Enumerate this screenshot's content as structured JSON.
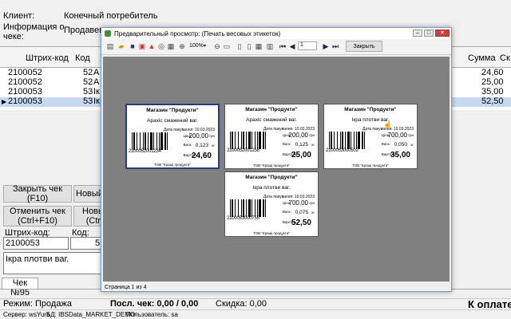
{
  "info": {
    "client_label": "Клиент:",
    "client_value": "Конечный потребитель",
    "receipt_info_label": "Информация о\nчеке:",
    "seller_label": "Продавец:"
  },
  "grid": {
    "columns": [
      "Штрих-код",
      "Код",
      "Сумма",
      "Ск"
    ],
    "rows": [
      {
        "barcode": "2100052",
        "code": "52",
        "name_frag": "А",
        "sum": "24,60",
        "selected": false
      },
      {
        "barcode": "2100052",
        "code": "52",
        "name_frag": "А",
        "sum": "25,00",
        "selected": false
      },
      {
        "barcode": "2100053",
        "code": "53",
        "name_frag": "Ік",
        "sum": "35,00",
        "selected": false
      },
      {
        "barcode": "2100053",
        "code": "53",
        "name_frag": "Ік",
        "sum": "52,50",
        "selected": true
      }
    ]
  },
  "buttons": {
    "close_receipt": "Закрыть чек (F10)",
    "new_frag": "Новый",
    "cancel_receipt": "Отменить чек\n(Ctrl+F10)",
    "new2_frag": "Новы\n(Ctr"
  },
  "inputs": {
    "barcode_label": "Штрих-код:",
    "barcode_value": "2100053",
    "code_label": "Код:",
    "code_value": "53",
    "product_name": "Ікра плотви ваг."
  },
  "tab": "Чек №95",
  "status": {
    "mode": "Режим: Продажа",
    "last_receipt": "Посл. чек: 0,00 / 0,00",
    "discount": "Скидка: 0,00",
    "to_pay": "К оплате"
  },
  "bottom_bar": {
    "server": "Сервер: wsYura",
    "db": "БД: IBSData_MARKET_DEMO",
    "user": "Пользователь: sa"
  },
  "dialog": {
    "title": "Предварительный просмотр: (Печать весовых этикеток)",
    "zoom": "100%",
    "page_input": "1",
    "close_button": "Закрыть",
    "status_text": "Страница 1 из 4",
    "icons": [
      "print-icon",
      "open-icon",
      "save-icon",
      "pdf-icon",
      "find-icon",
      "zoom-icon",
      "zoom-out-icon",
      "zoom-in-icon",
      "page-setup-icon",
      "first-page-icon",
      "prev-page-icon",
      "next-page-icon",
      "last-page-icon"
    ]
  },
  "labels": [
    {
      "shop": "Магазин \"Продукти\"",
      "name": "Арахіс смажений ваг.",
      "date": "Дата пакування: 10.03.2023",
      "price_key": "Ціна:",
      "price": "200,00",
      "unit": "грн",
      "weight_key": "Вага:",
      "weight": "0,123",
      "weight_unit": "кг",
      "total_key": "Вартість:",
      "total": "24,60",
      "code": "2100052001234",
      "maker": "ТОВ \"Кращі продукти\""
    },
    {
      "shop": "Магазин \"Продукти\"",
      "name": "Арахіс смажений ваг.",
      "date": "Дата пакування: 10.03.2023",
      "price_key": "Ціна:",
      "price": "200,00",
      "unit": "грн",
      "weight_key": "Вага:",
      "weight": "0,125",
      "weight_unit": "кг",
      "total_key": "Вартість:",
      "total": "25,00",
      "code": "2100052001258",
      "maker": "ТОВ \"Кращі продукти\""
    },
    {
      "shop": "Магазин \"Продукти\"",
      "name": "Ікра плотви ваг.",
      "date": "Дата пакування: 10.03.2023",
      "price_key": "Ціна:",
      "price": "700,00",
      "unit": "грн",
      "weight_key": "Вага:",
      "weight": "0,050",
      "weight_unit": "кг",
      "total_key": "Вартість:",
      "total": "35,00",
      "code": "2100053000502",
      "maker": "ТОВ \"Кращі продукти\""
    },
    {
      "shop": "Магазин \"Продукти\"",
      "name": "Ікра плотви ваг.",
      "date": "Дата пакування: 10.03.2023",
      "price_key": "Ціна:",
      "price": "700,00",
      "unit": "грн",
      "weight_key": "Вага:",
      "weight": "0,075",
      "weight_unit": "кг",
      "total_key": "Вартість:",
      "total": "52,50",
      "code": "2100053000755",
      "maker": "ТОВ \"Кращі продукти\""
    }
  ]
}
